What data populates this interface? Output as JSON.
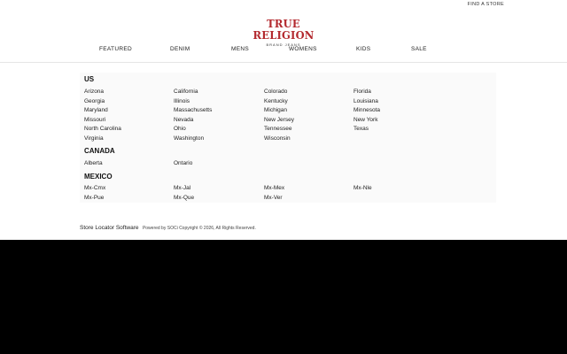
{
  "topbar": {
    "find_store": "FIND A STORE"
  },
  "logo": {
    "main": "TRUE RELIGION",
    "sub": "BRAND JEANS"
  },
  "nav": [
    "FEATURED",
    "DENIM",
    "MENS",
    "WOMENS",
    "KIDS",
    "SALE"
  ],
  "countries": [
    {
      "name": "US",
      "regions": [
        "Arizona",
        "California",
        "Colorado",
        "Florida",
        "Georgia",
        "Illinois",
        "Kentucky",
        "Louisiana",
        "Maryland",
        "Massachusetts",
        "Michigan",
        "Minnesota",
        "Missouri",
        "Nevada",
        "New Jersey",
        "New York",
        "North Carolina",
        "Ohio",
        "Tennessee",
        "Texas",
        "Virginia",
        "Washington",
        "Wisconsin"
      ]
    },
    {
      "name": "CANADA",
      "regions": [
        "Alberta",
        "Ontario"
      ]
    },
    {
      "name": "MEXICO",
      "regions": [
        "Mx-Cmx",
        "Mx-Jal",
        "Mx-Mex",
        "Mx-Nle",
        "Mx-Pue",
        "Mx-Que",
        "Mx-Ver"
      ]
    }
  ],
  "footer": {
    "link": "Store Locator Software",
    "powered": "Powered by SOCi Copyright © 2026, All Rights Reserved."
  }
}
